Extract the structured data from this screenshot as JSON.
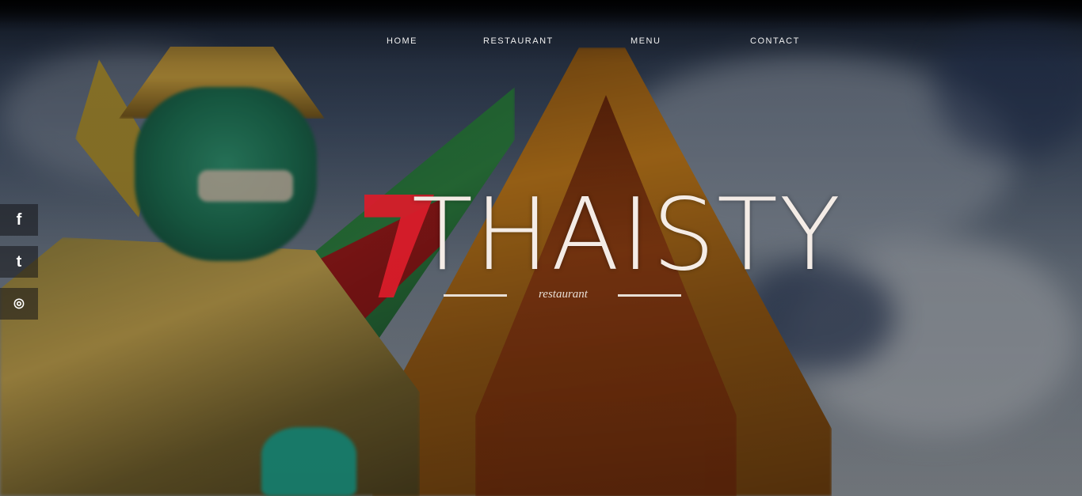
{
  "nav": {
    "items": [
      {
        "label": "Home"
      },
      {
        "label": "Restaurant"
      },
      {
        "label": "Menu"
      },
      {
        "label": "Contact"
      }
    ]
  },
  "logo": {
    "word": "THAISTY",
    "tagline": "restaurant",
    "accent_color": "#d81c2a"
  },
  "social": {
    "items": [
      {
        "icon": "facebook-icon",
        "glyph": "f"
      },
      {
        "icon": "twitter-icon",
        "glyph": "t"
      },
      {
        "icon": "instagram-icon",
        "glyph": "◎"
      }
    ]
  }
}
